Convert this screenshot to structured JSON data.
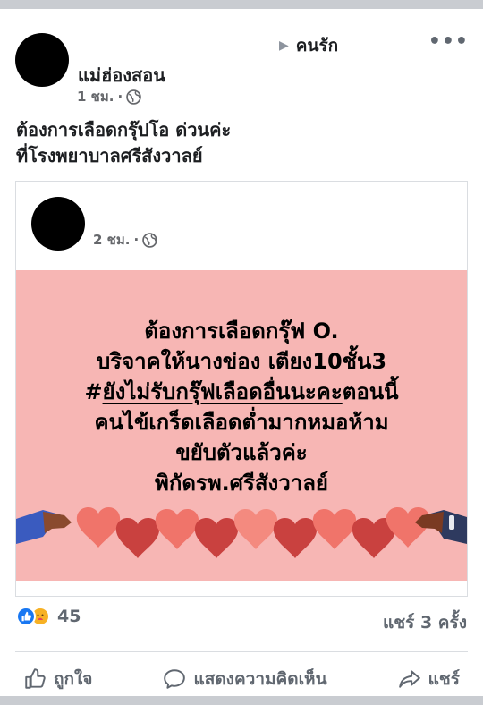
{
  "post": {
    "author": "แม่ฮ่องสอน",
    "time": "1 ชม.",
    "target_group": "คนรัก",
    "more_icon": "•••",
    "text_lines": [
      "ต้องการเลือดกรุ๊ปโอ ด่วนค่ะ",
      "ที่โรงพยาบาลศรีสังวาลย์"
    ]
  },
  "shared_post": {
    "time": "2 ชม.",
    "image_text": {
      "line1": "ต้องการเลือดกรุ๊ฟ O.",
      "line2": "บริจาคให้นางข่อง เตียง10ชั้น3",
      "line3_hash": "#",
      "line3_underlined": "ยังไม่รับกรุ๊ฟเลือดอื่นนะคะ",
      "line3_rest": "ตอนนี้",
      "line4": "คนไข้เกร็ดเลือดต่ำมากหมอห้าม",
      "line5": "ขยับตัวแล้วค่ะ",
      "line6": "พิกัดรพ.ศรีสังวาลย์"
    }
  },
  "stats": {
    "reaction_count": "45",
    "shares": "แชร์ 3 ครั้ง"
  },
  "actions": {
    "like": "ถูกใจ",
    "comment": "แสดงความคิดเห็น",
    "share": "แชร์"
  },
  "colors": {
    "image_background": "#f7b6b4",
    "like_blue": "#1877f2",
    "heart_red": "#e0504a"
  },
  "icons": [
    "globe-icon",
    "like-icon",
    "comment-icon",
    "share-icon",
    "heart-icon"
  ]
}
